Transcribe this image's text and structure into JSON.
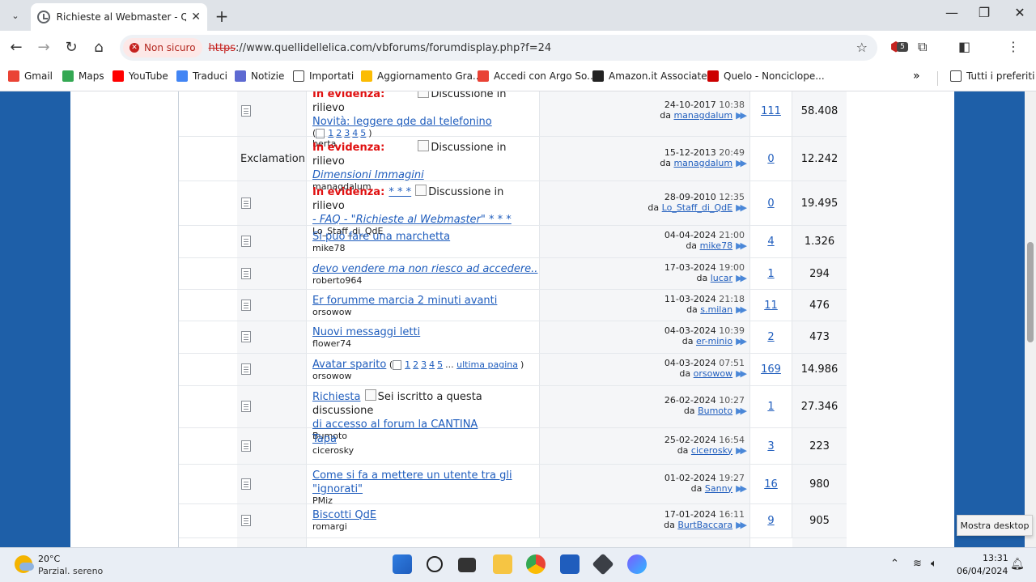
{
  "browser": {
    "tab_title": "Richieste al Webmaster - Quelli",
    "security_label": "Non sicuro",
    "url_scheme": "https",
    "url_rest": "://www.quellidellelica.com/vbforums/forumdisplay.php?f=24",
    "extension_badge": "5",
    "bookmarks": [
      {
        "label": "Gmail",
        "color": "#ea4335"
      },
      {
        "label": "Maps",
        "color": "#34a853"
      },
      {
        "label": "YouTube",
        "color": "#ff0000"
      },
      {
        "label": "Traduci",
        "color": "#4285f4"
      },
      {
        "label": "Notizie",
        "color": "#5e6ad2"
      },
      {
        "label": "Importati",
        "color": "#ffffff"
      },
      {
        "label": "Aggiornamento Gra...",
        "color": "#fbbc04"
      },
      {
        "label": "Accedi con Argo So...",
        "color": "#e94235"
      },
      {
        "label": "Amazon.it Associate...",
        "color": "#222222"
      },
      {
        "label": "Quelo - Nonciclope...",
        "color": "#cc0000"
      }
    ],
    "all_bookmarks": "Tutti i preferiti"
  },
  "threads": [
    {
      "sticky_label": "In evidenza:",
      "sticky_img": "Discussione in rilievo",
      "title": "Novità: leggere qde dal telefonino",
      "italic": false,
      "pages": [
        "1",
        "2",
        "3",
        "4",
        "5"
      ],
      "starter": "berta",
      "date": "24-10-2017",
      "time": "10:38",
      "by_prefix": "da",
      "last_user": "managdalum",
      "replies": "111",
      "views": "58.408"
    },
    {
      "sticky_label": "In evidenza:",
      "sticky_img": "Discussione in rilievo",
      "title": "Dimensioni Immagini",
      "italic": true,
      "post_icon_alt": "Exclamation",
      "starter": "managdalum",
      "date": "15-12-2013",
      "time": "20:49",
      "by_prefix": "da",
      "last_user": "managdalum",
      "replies": "0",
      "views": "12.242"
    },
    {
      "sticky_label": "In evidenza:",
      "sticky_img": "Discussione in rilievo",
      "title_pre": "* * *",
      "title": "- FAQ - \"Richieste al Webmaster\" * * *",
      "italic": true,
      "starter": "Lo_Staff_di_QdE",
      "date": "28-09-2010",
      "time": "12:35",
      "by_prefix": "da",
      "last_user": "Lo_Staff_di_QdE",
      "replies": "0",
      "views": "19.495"
    },
    {
      "title": "Si può fare una marchetta",
      "italic": false,
      "starter": "mike78",
      "date": "04-04-2024",
      "time": "21:00",
      "by_prefix": "da",
      "last_user": "mike78",
      "replies": "4",
      "views": "1.326"
    },
    {
      "title": "devo vendere ma non riesco ad accedere..",
      "italic": true,
      "starter": "roberto964",
      "date": "17-03-2024",
      "time": "19:00",
      "by_prefix": "da",
      "last_user": "lucar",
      "replies": "1",
      "views": "294"
    },
    {
      "title": "Er forumme marcia 2 minuti avanti",
      "italic": false,
      "starter": "orsowow",
      "date": "11-03-2024",
      "time": "21:18",
      "by_prefix": "da",
      "last_user": "s.milan",
      "replies": "11",
      "views": "476"
    },
    {
      "title": "Nuovi messaggi letti",
      "italic": false,
      "starter": "flower74",
      "date": "04-03-2024",
      "time": "10:39",
      "by_prefix": "da",
      "last_user": "er-minio",
      "replies": "2",
      "views": "473"
    },
    {
      "title": "Avatar sparito",
      "italic": false,
      "pages": [
        "1",
        "2",
        "3",
        "4",
        "5"
      ],
      "pages_more": "...",
      "last_page": "ultima pagina",
      "starter": "orsowow",
      "date": "04-03-2024",
      "time": "07:51",
      "by_prefix": "da",
      "last_user": "orsowow",
      "replies": "169",
      "views": "14.986"
    },
    {
      "title": "Richiesta",
      "subscribed_img": "Sei iscritto a questa discussione",
      "title_cont": "di accesso al forum la CANTINA",
      "italic": false,
      "starter": "Bumoto",
      "date": "26-02-2024",
      "time": "10:27",
      "by_prefix": "da",
      "last_user": "Bumoto",
      "replies": "1",
      "views": "27.346"
    },
    {
      "title": "Tapa",
      "italic": false,
      "starter": "cicerosky",
      "date": "25-02-2024",
      "time": "16:54",
      "by_prefix": "da",
      "last_user": "cicerosky",
      "replies": "3",
      "views": "223"
    },
    {
      "title": "Come si fa a mettere un utente tra gli",
      "title_cont": "\"ignorati\"",
      "italic": false,
      "starter": "PMiz",
      "date": "01-02-2024",
      "time": "19:27",
      "by_prefix": "da",
      "last_user": "Sanny",
      "replies": "16",
      "views": "980"
    },
    {
      "title": "Biscotti QdE",
      "italic": false,
      "starter": "romargi",
      "date": "17-01-2024",
      "time": "16:11",
      "by_prefix": "da",
      "last_user": "BurtBaccara",
      "replies": "9",
      "views": "905"
    }
  ],
  "tooltip": "Mostra desktop",
  "taskbar": {
    "weather_temp": "20°C",
    "weather_desc": "Parzial. sereno",
    "time": "13:31",
    "date": "06/04/2024"
  }
}
